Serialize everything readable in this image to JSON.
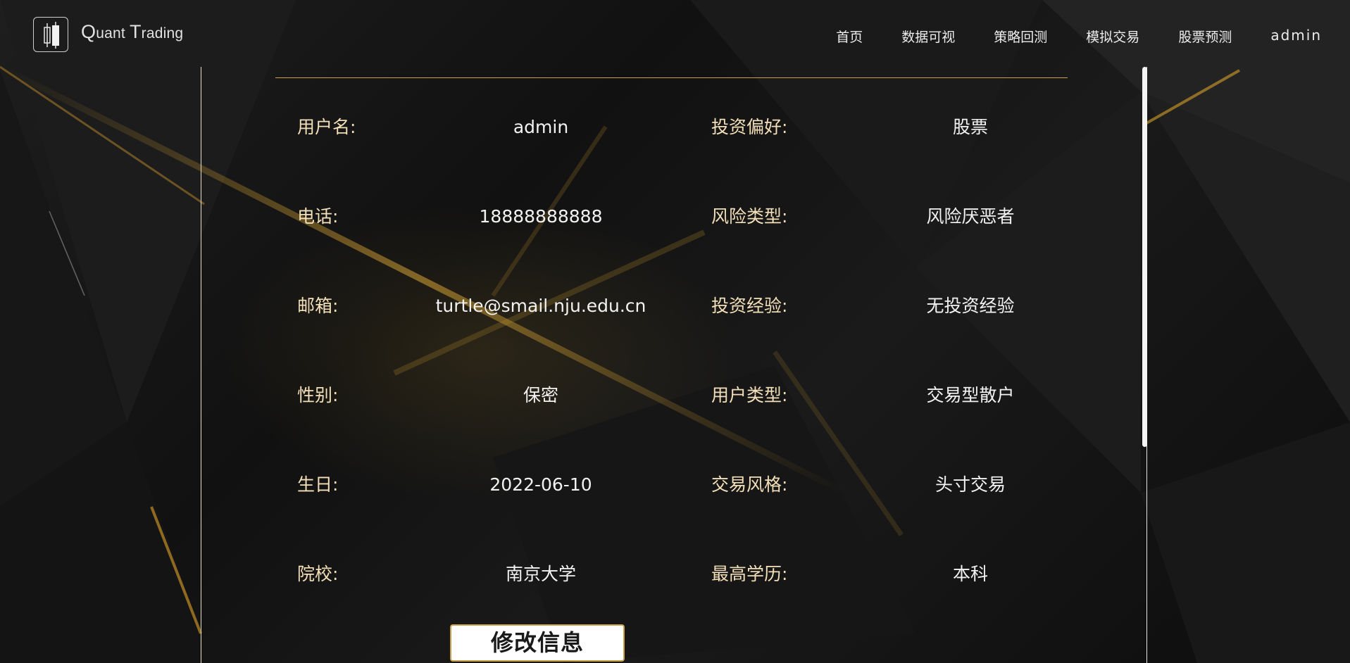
{
  "brand": {
    "first_cap": "Q",
    "first_rest": "uant",
    "second_cap": "T",
    "second_rest": "rading"
  },
  "nav": {
    "items": [
      {
        "label": "首页"
      },
      {
        "label": "数据可视"
      },
      {
        "label": "策略回测"
      },
      {
        "label": "模拟交易"
      },
      {
        "label": "股票预测"
      }
    ],
    "user": "admin"
  },
  "profile": {
    "rows": [
      {
        "left_label": "用户名:",
        "left_value": "admin",
        "right_label": "投资偏好:",
        "right_value": "股票"
      },
      {
        "left_label": "电话:",
        "left_value": "18888888888",
        "right_label": "风险类型:",
        "right_value": "风险厌恶者"
      },
      {
        "left_label": "邮箱:",
        "left_value": "turtle@smail.nju.edu.cn",
        "right_label": "投资经验:",
        "right_value": "无投资经验"
      },
      {
        "left_label": "性别:",
        "left_value": "保密",
        "right_label": "用户类型:",
        "right_value": "交易型散户"
      },
      {
        "left_label": "生日:",
        "left_value": "2022-06-10",
        "right_label": "交易风格:",
        "right_value": "头寸交易"
      },
      {
        "left_label": "院校:",
        "left_value": "南京大学",
        "right_label": "最高学历:",
        "right_value": "本科"
      }
    ],
    "edit_button": "修改信息"
  },
  "colors": {
    "accent_gold": "#c9a14a",
    "label_text": "#f3dfb8",
    "background": "#121212"
  },
  "icons": {
    "logo": "candlestick-logo-icon"
  }
}
